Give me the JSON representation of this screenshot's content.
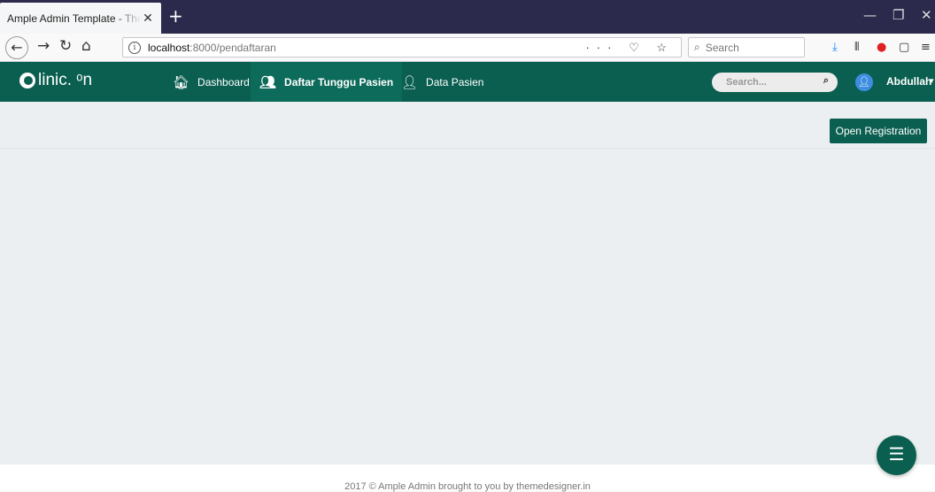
{
  "browser": {
    "tab_title": "Ample Admin Template - The Ultimate Multipurpose admin template",
    "tab_close": "✕",
    "new_tab": "+",
    "url_host": "localhost",
    "url_path": ":8000/pendaftaran",
    "url_actions": "··· ♡ ☆",
    "search_placeholder": "Search"
  },
  "app": {
    "logo_text": "linic. ᵒn",
    "menu": [
      {
        "label": "Dashboard",
        "icon": "home-icon"
      },
      {
        "label": "Daftar Tunggu Pasien",
        "icon": "users-icon",
        "active": true
      },
      {
        "label": "Data Pasien",
        "icon": "patient-icon"
      }
    ],
    "search_placeholder": "Search...",
    "user_name": "Abdullah"
  },
  "content": {
    "open_registration_label": "Open Registration"
  },
  "footer": {
    "text": "2017 © Ample Admin brought to you by themedesigner.in"
  },
  "colors": {
    "brand": "#0b5f50",
    "tabstrip": "#2b2a4c",
    "background": "#eceff1"
  }
}
